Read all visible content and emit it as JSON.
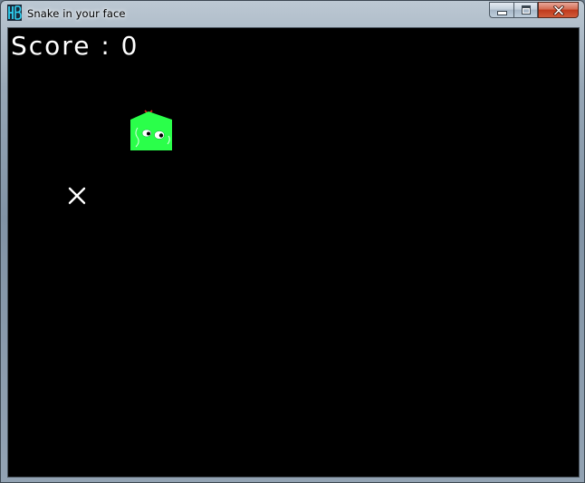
{
  "window": {
    "title": "Snake in your face",
    "app_icon": "hb-logo-icon",
    "controls": [
      "minimize-button",
      "maximize-button",
      "close-button"
    ]
  },
  "game": {
    "score_label": "Score : 0",
    "snake_color": "#2aff4a",
    "food_icon": "x-mark-icon",
    "background": "#000000"
  }
}
